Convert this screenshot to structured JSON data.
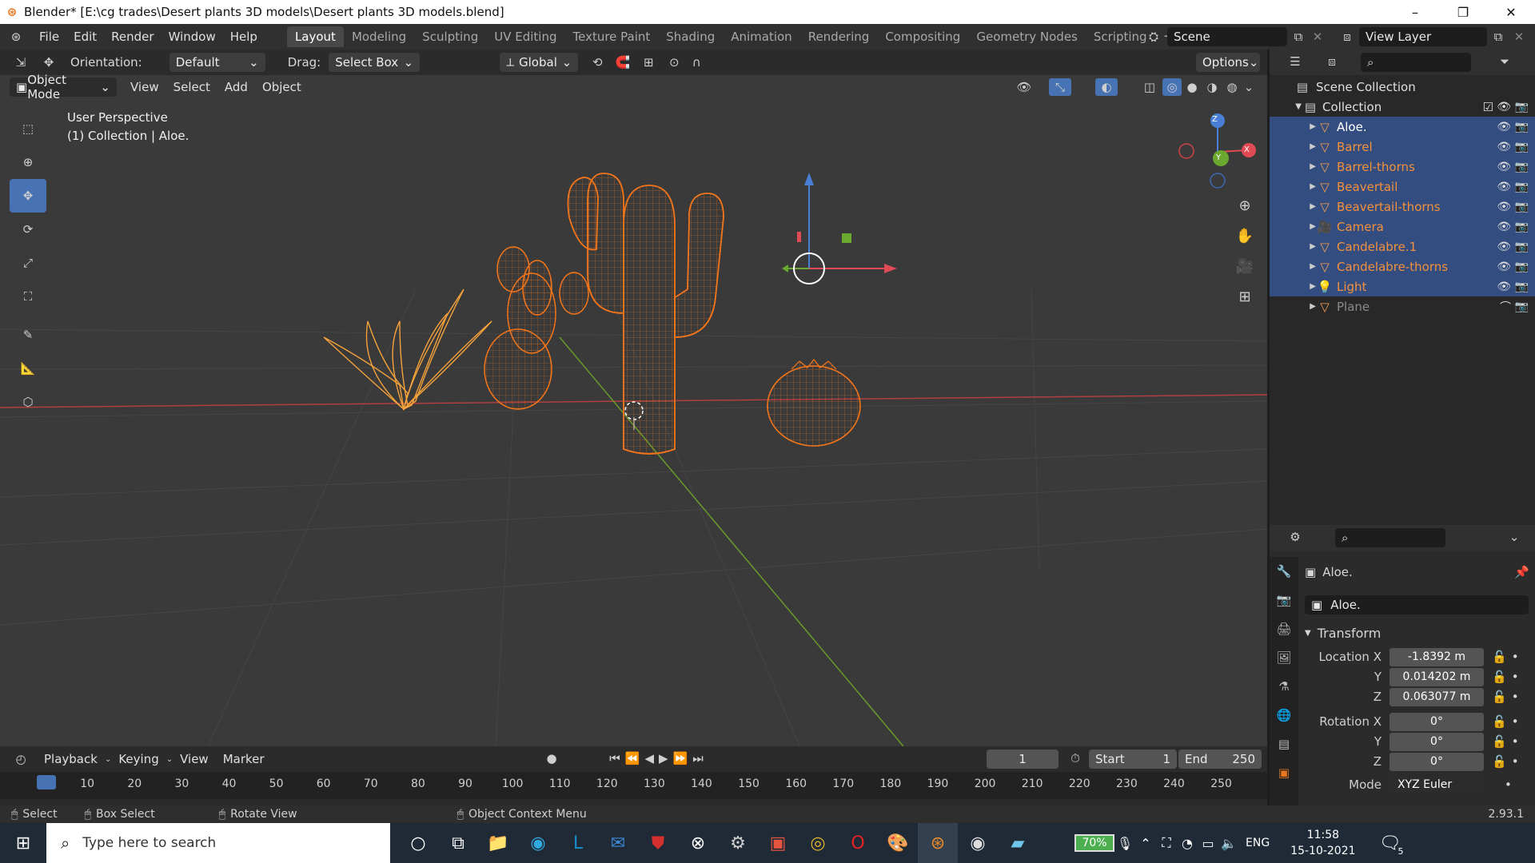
{
  "window": {
    "title": "Blender* [E:\\cg trades\\Desert plants 3D models\\Desert plants 3D models.blend]",
    "controls": [
      "–",
      "❐",
      "✕"
    ]
  },
  "menu": [
    "File",
    "Edit",
    "Render",
    "Window",
    "Help"
  ],
  "workspaces": {
    "tabs": [
      "Layout",
      "Modeling",
      "Sculpting",
      "UV Editing",
      "Texture Paint",
      "Shading",
      "Animation",
      "Rendering",
      "Compositing",
      "Geometry Nodes",
      "Scripting"
    ],
    "active": "Layout",
    "add": "+"
  },
  "scene": {
    "label": "Scene",
    "view_layer": "View Layer"
  },
  "header": {
    "orientation_label": "Orientation:",
    "orientation_value": "Default",
    "drag_label": "Drag:",
    "drag_value": "Select Box",
    "transform_orientation": "Global",
    "options": "Options"
  },
  "header2": {
    "mode": "Object Mode",
    "menus": [
      "View",
      "Select",
      "Add",
      "Object"
    ]
  },
  "viewport": {
    "info_line1": "User Perspective",
    "info_line2": "(1) Collection | Aloe.",
    "gizmo_axes": [
      "X",
      "Y",
      "Z"
    ],
    "colors": {
      "wire": "#f5761a",
      "grid": "#434343",
      "x_axis": "#c04040",
      "y_axis": "#6a9a2a"
    }
  },
  "outliner": {
    "scene_collection": "Scene Collection",
    "collection": "Collection",
    "items": [
      {
        "name": "Aloe.",
        "type": "mesh",
        "selected": true,
        "active": true
      },
      {
        "name": "Barrel",
        "type": "mesh",
        "selected": true
      },
      {
        "name": "Barrel-thorns",
        "type": "mesh",
        "selected": true
      },
      {
        "name": "Beavertail",
        "type": "mesh",
        "selected": true
      },
      {
        "name": "Beavertail-thorns",
        "type": "mesh",
        "selected": true
      },
      {
        "name": "Camera",
        "type": "camera",
        "selected": true
      },
      {
        "name": "Candelabre.1",
        "type": "mesh",
        "selected": true
      },
      {
        "name": "Candelabre-thorns",
        "type": "mesh",
        "selected": true
      },
      {
        "name": "Light",
        "type": "light",
        "selected": true
      },
      {
        "name": "Plane",
        "type": "mesh",
        "selected": false
      }
    ]
  },
  "properties": {
    "object_name": "Aloe.",
    "data_name": "Aloe.",
    "panel": "Transform",
    "location": {
      "label": "Location X",
      "x": "-1.8392 m",
      "y": "0.014202 m",
      "z": "0.063077 m"
    },
    "rotation": {
      "label": "Rotation X",
      "x": "0°",
      "y": "0°",
      "z": "0°"
    },
    "axis_y": "Y",
    "axis_z": "Z",
    "mode_label": "Mode",
    "mode_value": "XYZ Euler",
    "version": "2.93.1"
  },
  "timeline": {
    "menus": [
      "Playback",
      "Keying",
      "View",
      "Marker"
    ],
    "current_frame": "1",
    "start_label": "Start",
    "start": "1",
    "end_label": "End",
    "end": "250",
    "ticks": [
      "1",
      "10",
      "20",
      "30",
      "40",
      "50",
      "60",
      "70",
      "80",
      "90",
      "100",
      "110",
      "120",
      "130",
      "140",
      "150",
      "160",
      "170",
      "180",
      "190",
      "200",
      "210",
      "220",
      "230",
      "240",
      "250"
    ]
  },
  "statusbar": {
    "select": "Select",
    "box_select": "Box Select",
    "rotate_view": "Rotate View",
    "context_menu": "Object Context Menu"
  },
  "taskbar": {
    "search_placeholder": "Type here to search",
    "battery": "70%",
    "lang": "ENG",
    "time": "11:58",
    "date": "15-10-2021",
    "notif_count": "5"
  }
}
